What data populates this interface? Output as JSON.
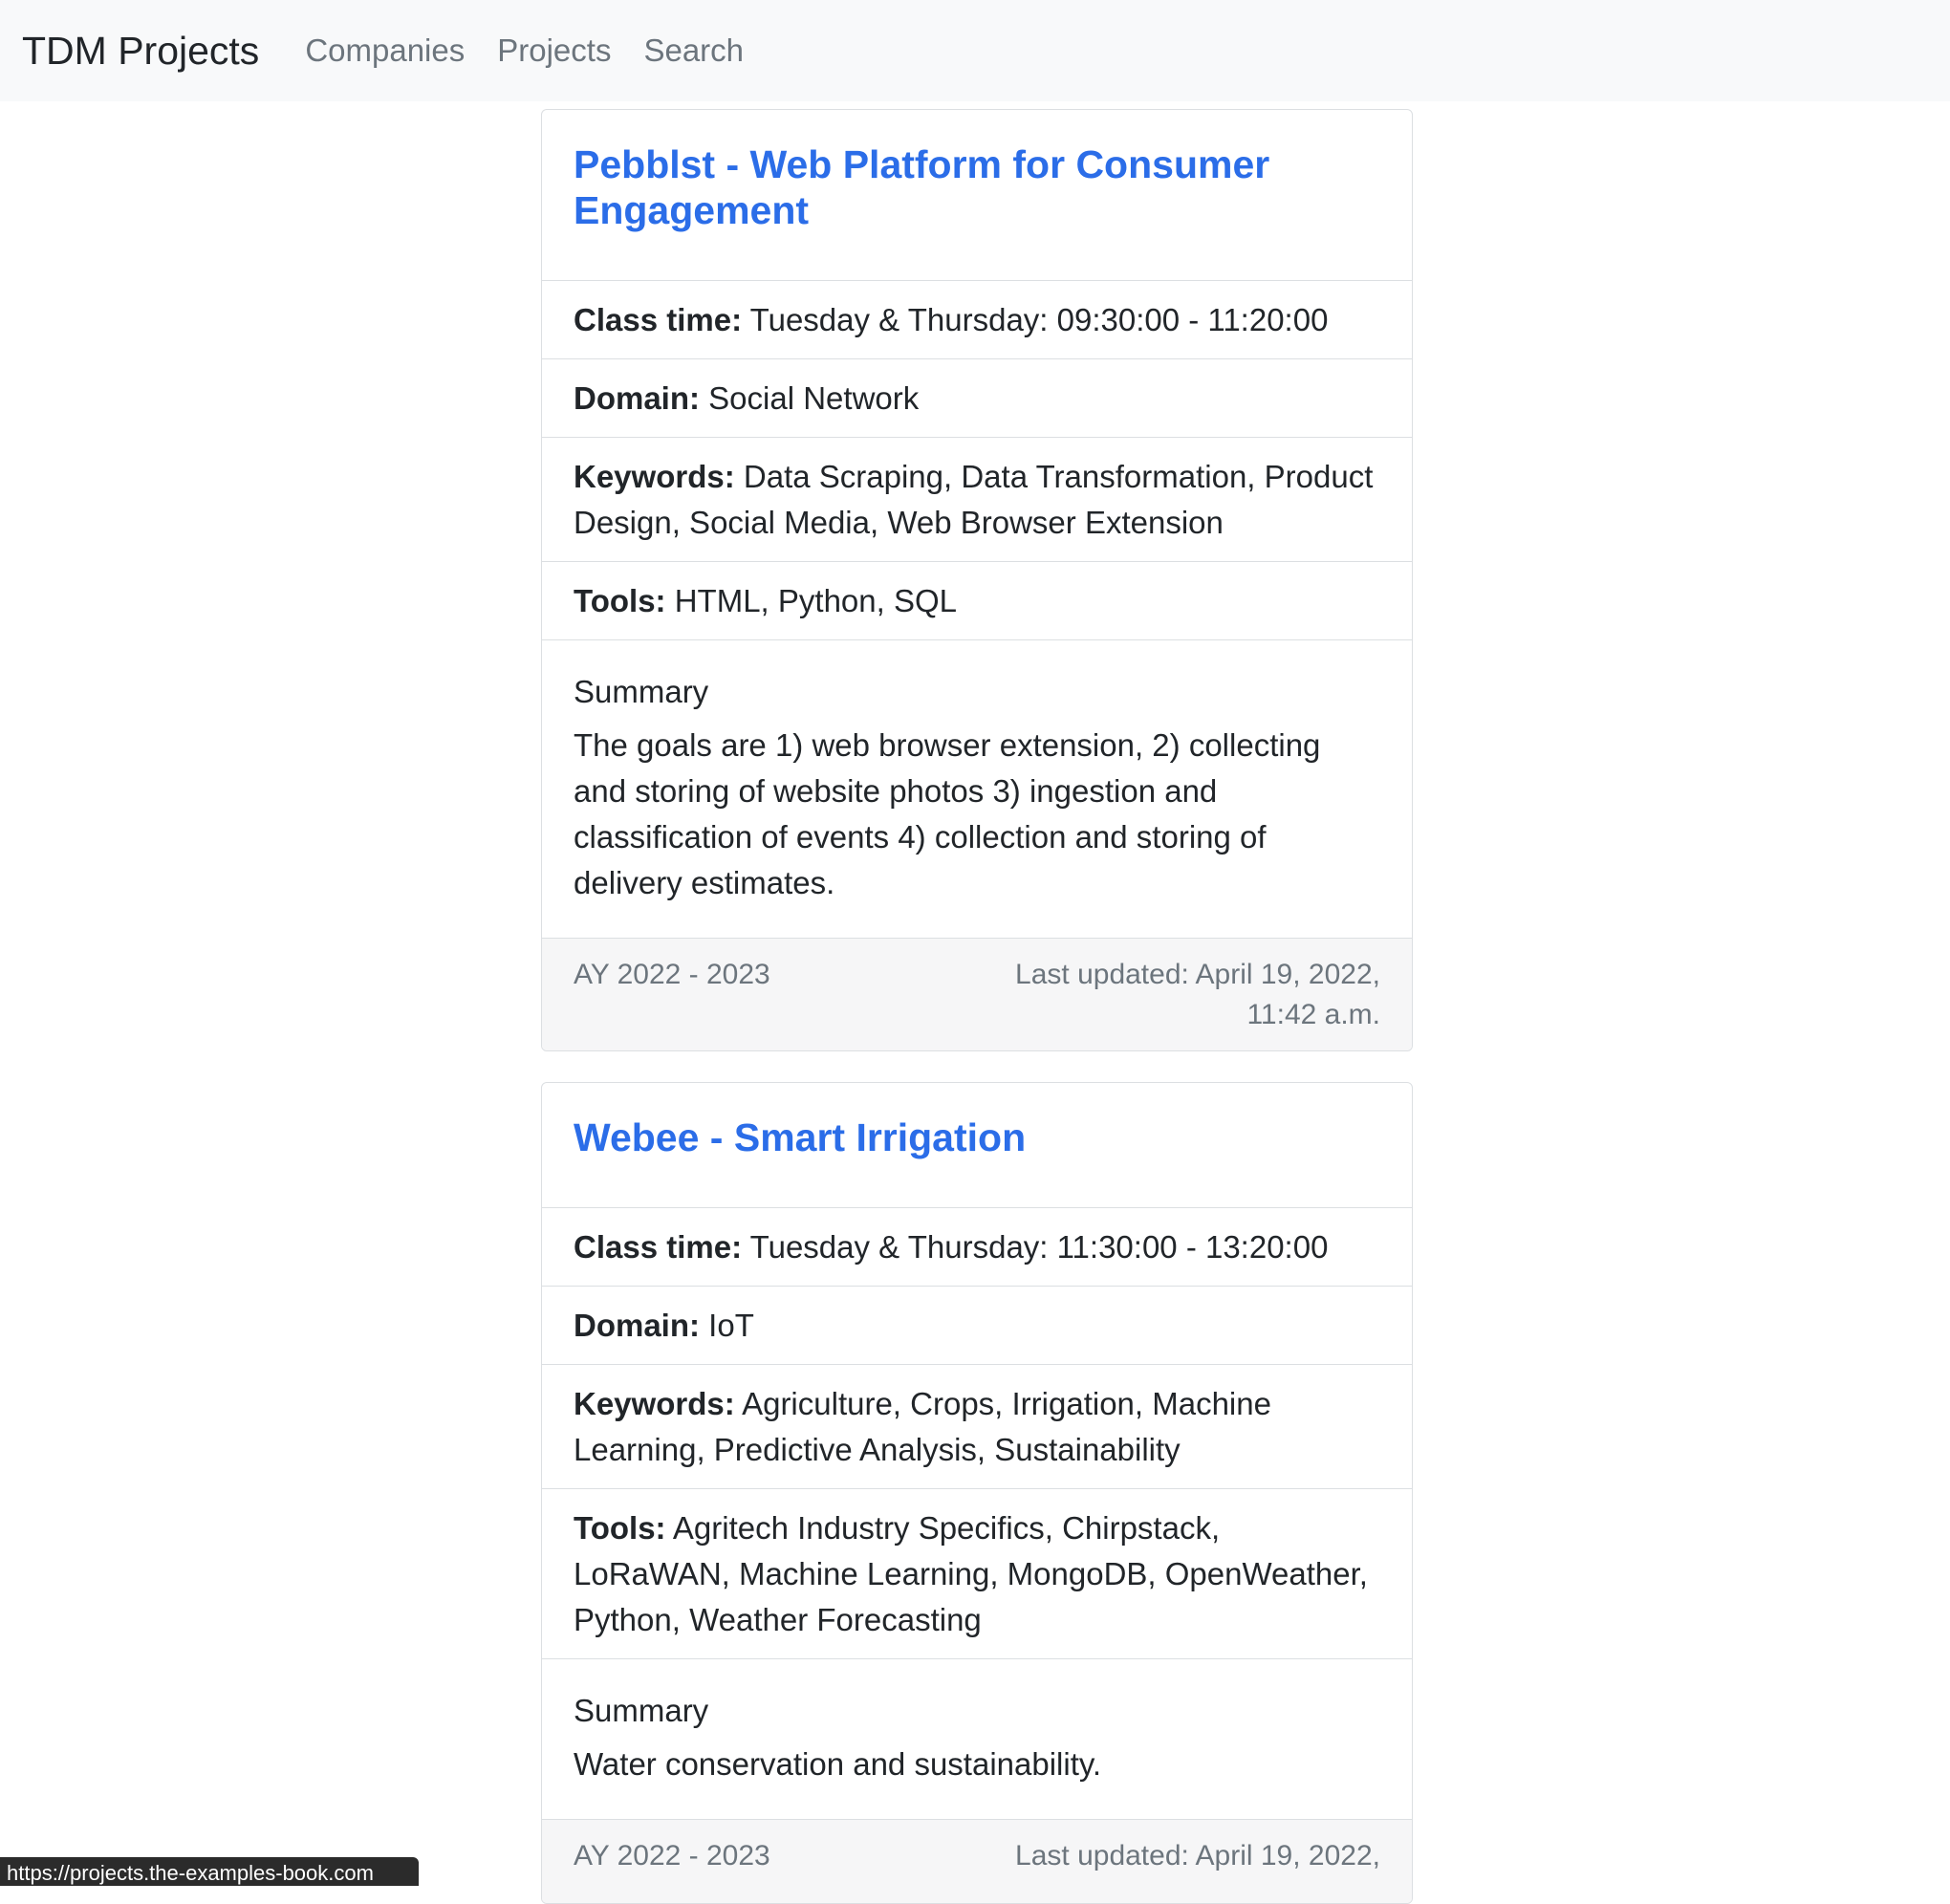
{
  "navbar": {
    "brand": "TDM Projects",
    "links": [
      "Companies",
      "Projects",
      "Search"
    ]
  },
  "projects": [
    {
      "title": "Pebblst - Web Platform for Consumer Engagement",
      "class_time_label": "Class time:",
      "class_time": "Tuesday & Thursday: 09:30:00 - 11:20:00",
      "domain_label": "Domain:",
      "domain": "Social Network",
      "keywords_label": "Keywords:",
      "keywords": "Data Scraping, Data Transformation, Product Design, Social Media, Web Browser Extension",
      "tools_label": "Tools:",
      "tools": "HTML, Python, SQL",
      "summary_heading": "Summary",
      "summary": "The goals are 1) web browser extension, 2) collecting and storing of website photos 3) ingestion and classification of events 4) collection and storing of delivery estimates.",
      "academic_year": "AY 2022 - 2023",
      "last_updated": "Last updated: April 19, 2022, 11:42 a.m."
    },
    {
      "title": "Webee - Smart Irrigation",
      "class_time_label": "Class time:",
      "class_time": "Tuesday & Thursday: 11:30:00 - 13:20:00",
      "domain_label": "Domain:",
      "domain": "IoT",
      "keywords_label": "Keywords:",
      "keywords": "Agriculture, Crops, Irrigation, Machine Learning, Predictive Analysis, Sustainability",
      "tools_label": "Tools:",
      "tools": "Agritech Industry Specifics, Chirpstack, LoRaWAN, Machine Learning, MongoDB, OpenWeather, Python, Weather Forecasting",
      "summary_heading": "Summary",
      "summary": "Water conservation and sustainability.",
      "academic_year": "AY 2022 - 2023",
      "last_updated": "Last updated: April 19, 2022,"
    }
  ],
  "status_bar": {
    "url": "https://projects.the-examples-book.com"
  }
}
